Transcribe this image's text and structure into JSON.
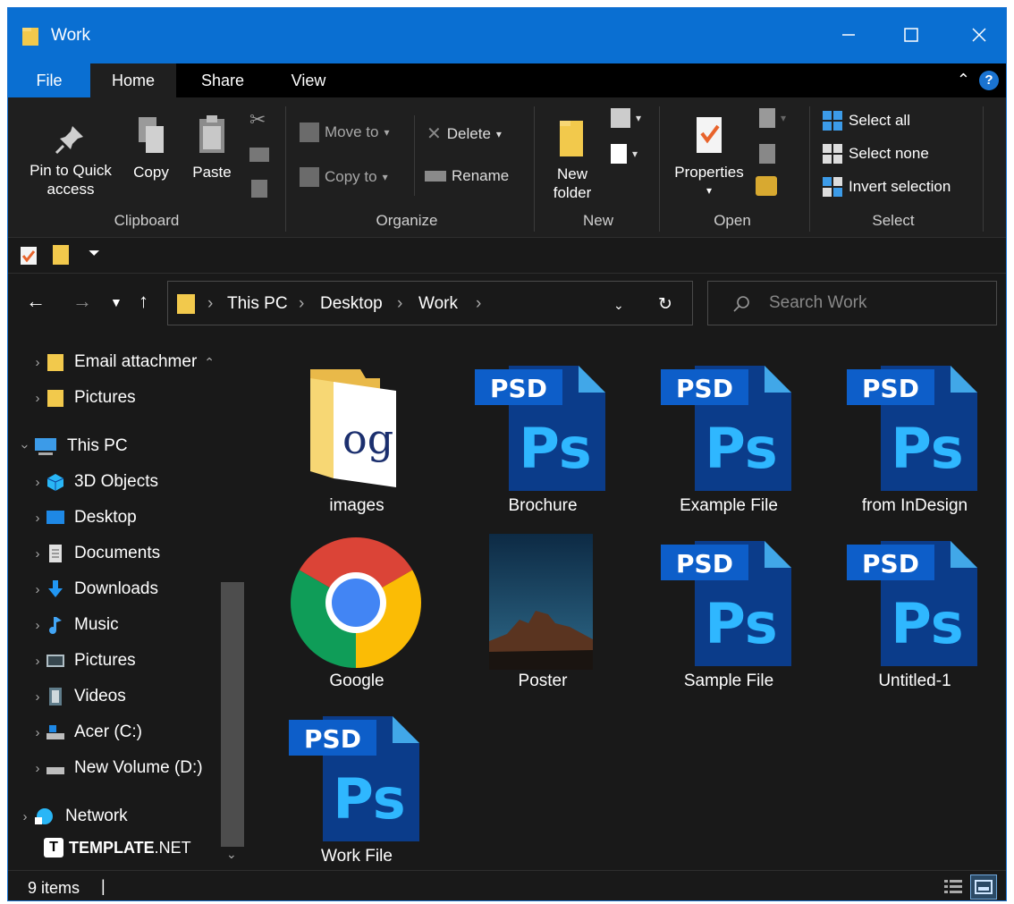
{
  "window": {
    "title": "Work"
  },
  "ribbon_tabs": [
    "File",
    "Home",
    "Share",
    "View"
  ],
  "clipboard": {
    "pin_label_1": "Pin to Quick",
    "pin_label_2": "access",
    "copy": "Copy",
    "paste": "Paste",
    "group": "Clipboard"
  },
  "organize": {
    "move_to": "Move to",
    "copy_to": "Copy to",
    "delete": "Delete",
    "rename": "Rename",
    "group": "Organize"
  },
  "new": {
    "folder_1": "New",
    "folder_2": "folder",
    "group": "New"
  },
  "open": {
    "properties": "Properties",
    "group": "Open"
  },
  "select": {
    "all": "Select all",
    "none": "Select none",
    "invert": "Invert selection",
    "group": "Select"
  },
  "address": {
    "crumbs": [
      "This PC",
      "Desktop",
      "Work"
    ]
  },
  "search": {
    "placeholder": "Search Work"
  },
  "nav": {
    "items": [
      {
        "label": "Email attachmer",
        "icon": "folder-icon"
      },
      {
        "label": "Pictures",
        "icon": "folder-icon"
      },
      {
        "label": "This PC",
        "icon": "computer-icon"
      },
      {
        "label": "3D Objects",
        "icon": "cube-icon"
      },
      {
        "label": "Desktop",
        "icon": "desktop-icon"
      },
      {
        "label": "Documents",
        "icon": "document-icon"
      },
      {
        "label": "Downloads",
        "icon": "download-icon"
      },
      {
        "label": "Music",
        "icon": "music-icon"
      },
      {
        "label": "Pictures",
        "icon": "pictures-icon"
      },
      {
        "label": "Videos",
        "icon": "video-icon"
      },
      {
        "label": "Acer (C:)",
        "icon": "drive-icon"
      },
      {
        "label": "New Volume (D:)",
        "icon": "drive-icon"
      },
      {
        "label": "Network",
        "icon": "network-icon"
      }
    ]
  },
  "files": [
    {
      "name": "images",
      "type": "folder"
    },
    {
      "name": "Brochure",
      "type": "psd"
    },
    {
      "name": "Example File",
      "type": "psd"
    },
    {
      "name": "from InDesign",
      "type": "psd"
    },
    {
      "name": "Google",
      "type": "chrome"
    },
    {
      "name": "Poster",
      "type": "image"
    },
    {
      "name": "Sample File",
      "type": "psd"
    },
    {
      "name": "Untitled-1",
      "type": "psd"
    },
    {
      "name": "Work File",
      "type": "psd"
    }
  ],
  "psd_badge": "PSD",
  "ps_text": "Ps",
  "folder_preview_text": "og",
  "status": {
    "count": "9 items"
  },
  "watermark": {
    "logo_letter": "T",
    "text": "TEMPLATE",
    "suffix": ".NET"
  }
}
